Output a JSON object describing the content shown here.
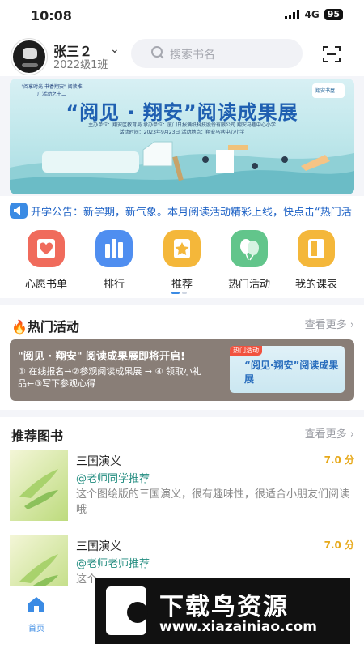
{
  "status_bar": {
    "time": "10:08",
    "network": "4G",
    "battery": "95"
  },
  "header": {
    "user_name": "张三２",
    "class_name": "2022级1班",
    "search_placeholder": "搜索书名"
  },
  "banner": {
    "top_note": "\"阅享时光 书香翔安\" 阅读推广活动之十二",
    "logo_text": "翔安书屋",
    "title": "“阅见 · 翔安”阅读成果展",
    "line1": "主办单位：翔安区教育局 承办单位：厦门日报满纸科技股份有限公司 翔安马巷中心小学",
    "line2": "活动时间：2023年9月23日 活动地点：翔安马巷中心小学"
  },
  "notice": {
    "text": "开学公告：新学期，新气象。本月阅读活动精彩上线，快点击“热门活"
  },
  "menu": [
    {
      "label": "心愿书单",
      "color": "#f06b5c"
    },
    {
      "label": "排行",
      "color": "#4f8ef0"
    },
    {
      "label": "推荐",
      "color": "#f4b73a"
    },
    {
      "label": "热门活动",
      "color": "#62c58b"
    },
    {
      "label": "我的课表",
      "color": "#f4b73a"
    }
  ],
  "hot": {
    "title": "热门活动",
    "more": "查看更多",
    "card_title": "\"阅见 · 翔安\" 阅读成果展即将开启!",
    "card_desc": "① 在线报名→②参观阅读成果展 → ④ 领取小礼品←③写下参观心得",
    "tag": "热门活动",
    "thumb_title": "“阅见·翔安”阅读成果展"
  },
  "books_section": {
    "title": "推荐图书",
    "more": "查看更多",
    "books": [
      {
        "name": "三国演义",
        "score": "7.0 分",
        "recommender": "@老师同学推荐",
        "desc": "这个图绘版的三国演义，很有趣味性，很适合小朋友们阅读哦"
      },
      {
        "name": "三国演义",
        "score": "7.0 分",
        "recommender": "@老师老师推荐",
        "desc": "这个"
      }
    ]
  },
  "tabbar": {
    "home_label": "首页"
  },
  "watermark": {
    "brand": "下载鸟资源",
    "url": "www.xiazainiao.com"
  }
}
